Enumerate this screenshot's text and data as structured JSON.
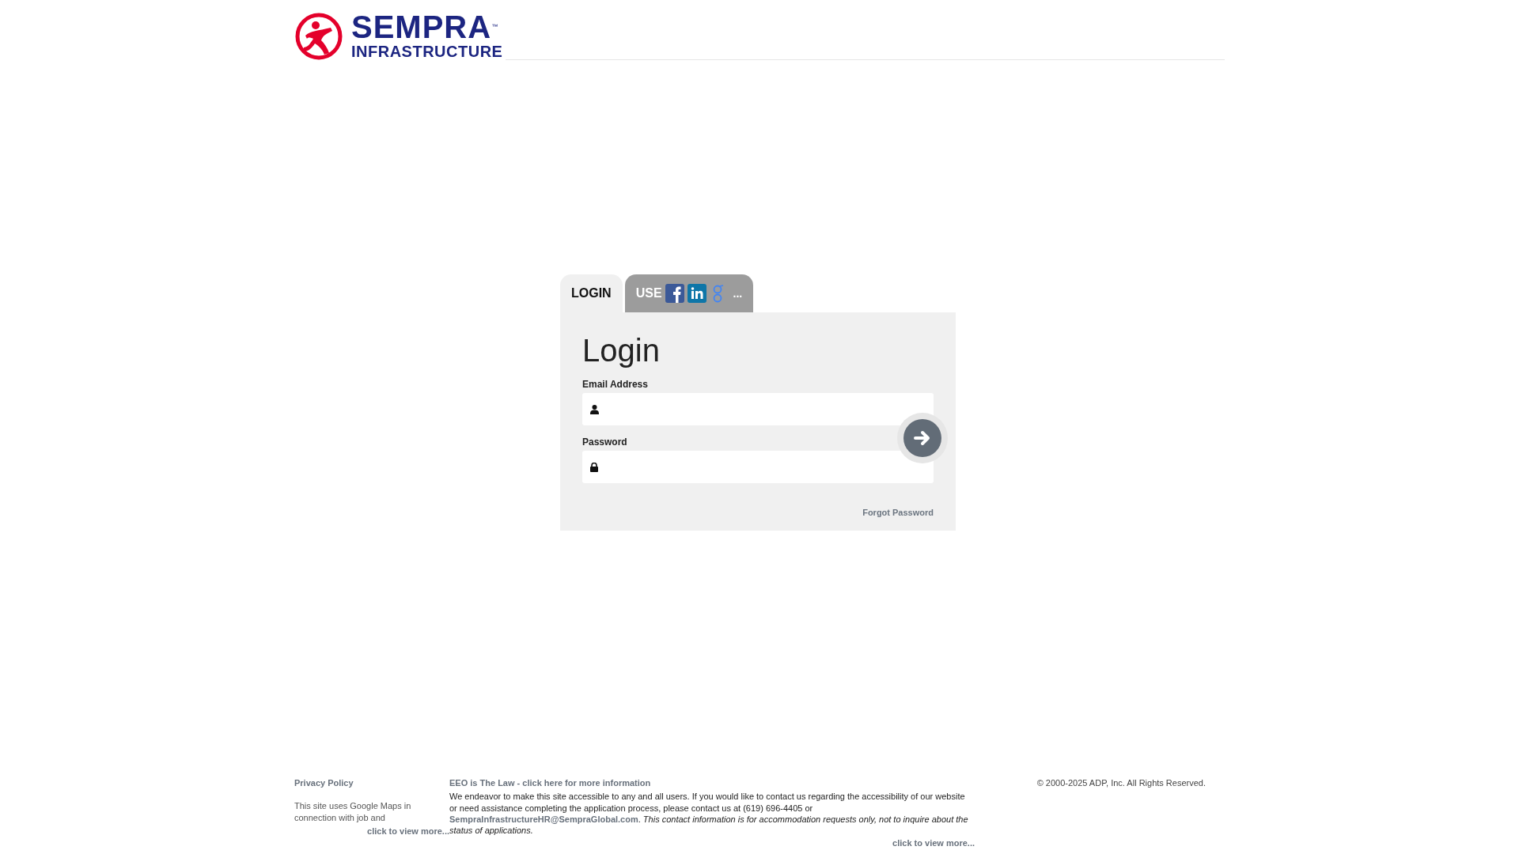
{
  "logo": {
    "name": "SEMPRA",
    "trademark": "™",
    "subtitle": "INFRASTRUCTURE"
  },
  "tabs": [
    {
      "kind": "text",
      "label": "LOGIN",
      "selected": true
    },
    {
      "kind": "social",
      "label": "USE",
      "more": "...",
      "selected": false
    }
  ],
  "form": {
    "title": "Login",
    "fields": [
      {
        "kind": "email",
        "label": "Email Address"
      },
      {
        "kind": "password",
        "label": "Password"
      }
    ],
    "forgot": "Forgot Password"
  },
  "footer": {
    "privacy": {
      "link": "Privacy Policy",
      "text": "This site uses Google Maps in connection with job and",
      "more": "click to view more..."
    },
    "eeo": {
      "link": "EEO is The Law - click here for more information",
      "text_before": "We endeavor to make this site accessible to any and all users. If you would like to contact us regarding the accessibility of our website or need assistance completing the application process, please contact us at (619) 696-4405 or ",
      "email": "SempraInfrastructureHR@SempraGlobal.com",
      "text_after": ". *This contact information is for accommodation requests only, not to inquire about the status of applications.*",
      "more": "click to view more..."
    },
    "copyright": "© 2000-2025 ADP, Inc. All Rights Reserved."
  }
}
